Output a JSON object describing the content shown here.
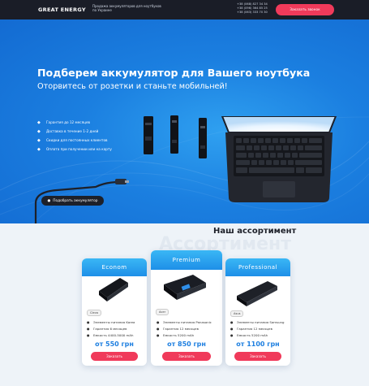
{
  "header": {
    "logo": "GREAT ENERGY",
    "tagline": "Продажа аккумуляторов для ноутбуков по Украине",
    "phones": [
      "+38 (068) 827 34 34",
      "+38 (096) 364 85 25",
      "+38 (063) 333 70 30"
    ],
    "call_button": "Заказать звонок"
  },
  "hero": {
    "title": "Подберем аккумулятор для Вашего ноутбука",
    "subtitle": "Оторвитесь от розетки и станьте мобильней!",
    "features": [
      "Гарантия до 12 месяцев",
      "Доставка в течение 1-2 дней",
      "Скидки для постоянных клиентов",
      "Оплата при получении или на карту"
    ],
    "pick_button": "Подобрать аккумулятор"
  },
  "assortment": {
    "title": "Наш ассортимент",
    "bg_word": "Ассортимент",
    "cards": [
      {
        "name": "Econom",
        "tag": "Clevo",
        "specs": [
          "Элементы питания Korea",
          "Гарантия 6 месяцев",
          "Емкость 4400-5000 mAh"
        ],
        "price": "от 550 грн",
        "button": "Заказать"
      },
      {
        "name": "Premium",
        "tag": "Acer",
        "specs": [
          "Элементы питания Panasonic",
          "Гарантия 12 месяцев",
          "Емкость 5200 mAh"
        ],
        "price": "от 850 грн",
        "button": "Заказать"
      },
      {
        "name": "Professional",
        "tag": "Asus",
        "specs": [
          "Элементы питания Samsung",
          "Гарантия 12 месяцев",
          "Емкость 5200 mAh"
        ],
        "price": "от 1100 грн",
        "button": "Заказать"
      }
    ]
  },
  "colors": {
    "accent": "#f03a5a",
    "hero_blue": "#1b7fe0",
    "card_header": "#2aa3ef",
    "dark": "#1a1d27"
  }
}
